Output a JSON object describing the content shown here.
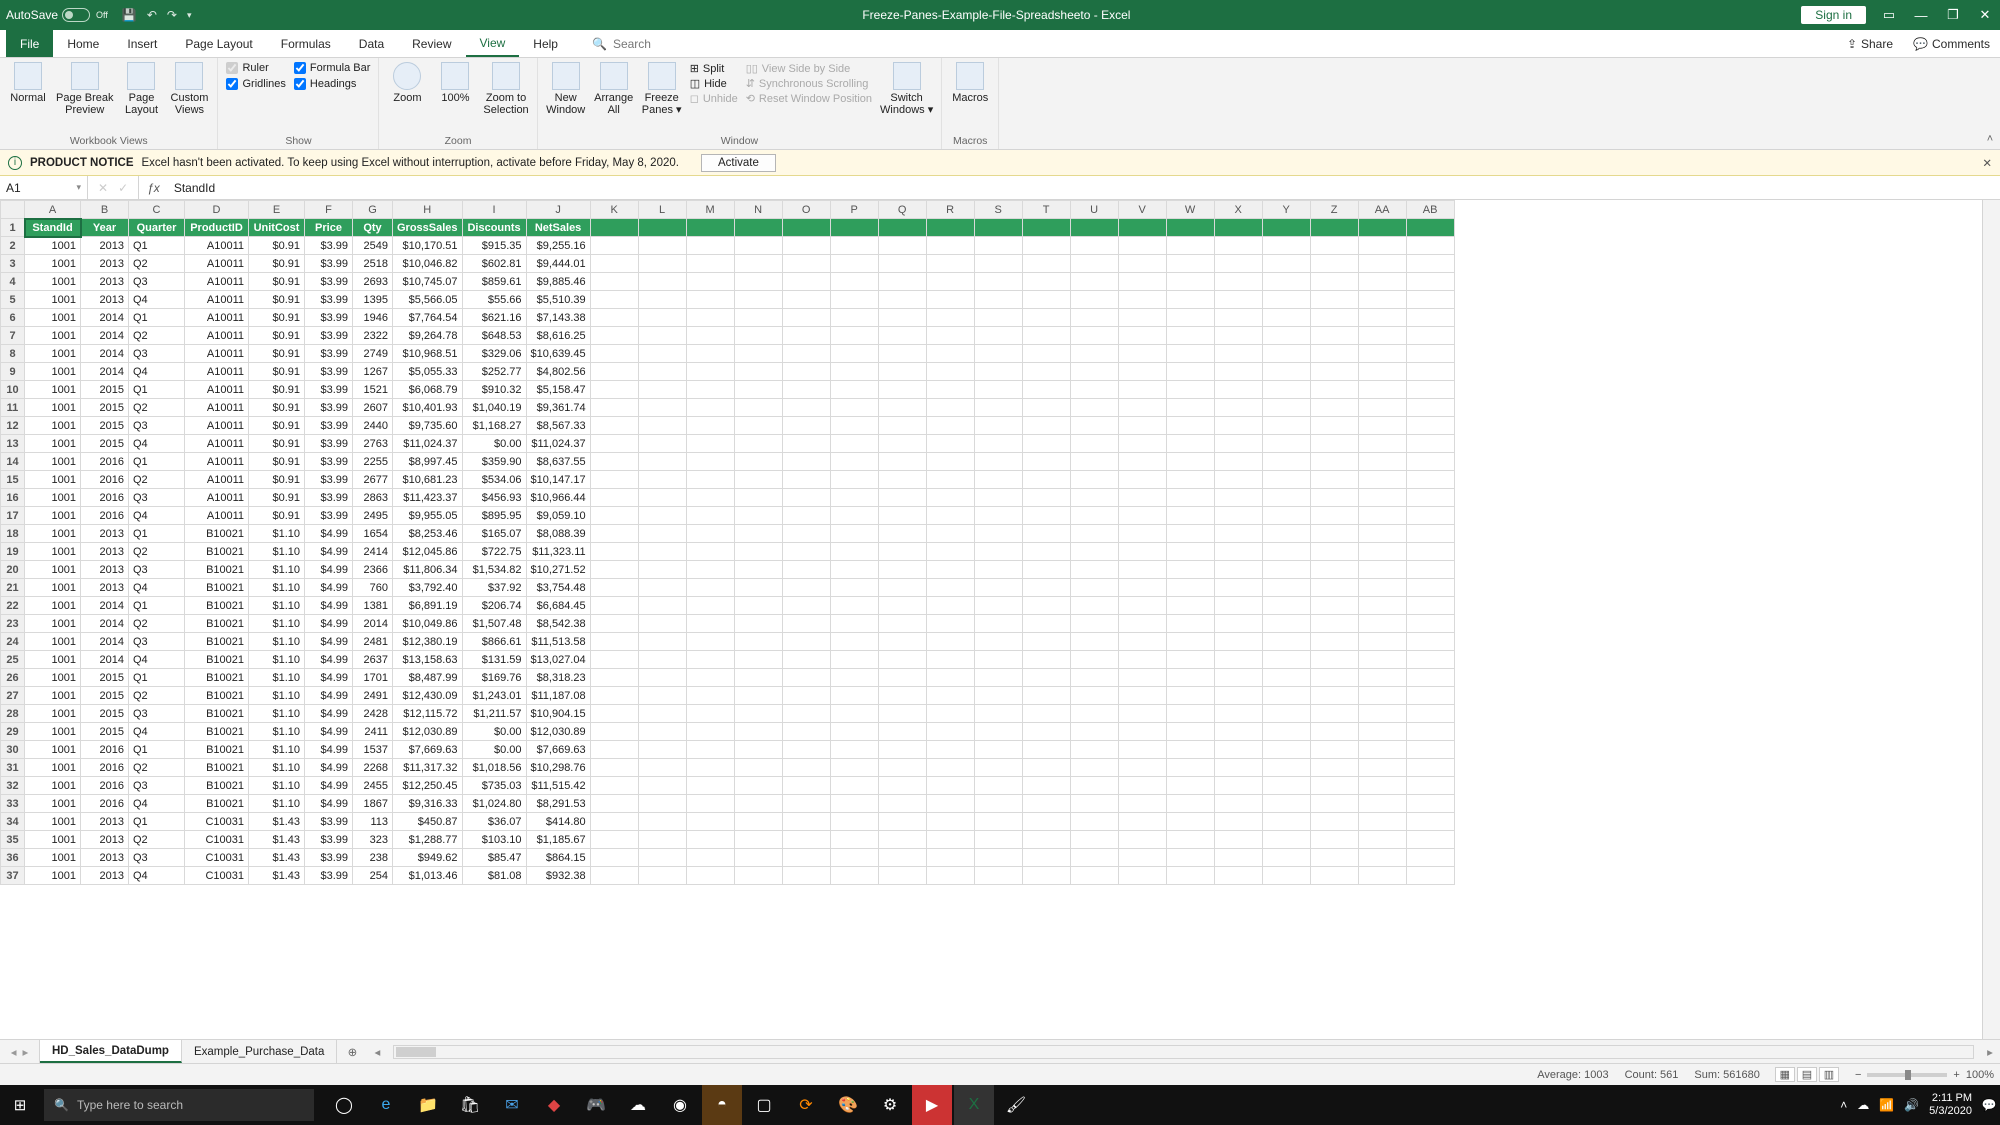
{
  "title_bar": {
    "autosave_label": "AutoSave",
    "autosave_state": "Off",
    "doc_title": "Freeze-Panes-Example-File-Spreadsheeto  -  Excel",
    "sign_in": "Sign in"
  },
  "menu": {
    "tabs": [
      "File",
      "Home",
      "Insert",
      "Page Layout",
      "Formulas",
      "Data",
      "Review",
      "View",
      "Help"
    ],
    "active_index": 7,
    "search_placeholder": "Search",
    "share": "Share",
    "comments": "Comments"
  },
  "ribbon": {
    "workbook_views": {
      "label": "Workbook Views",
      "normal": "Normal",
      "page_break": "Page Break\nPreview",
      "page_layout": "Page\nLayout",
      "custom_views": "Custom\nViews"
    },
    "show": {
      "label": "Show",
      "ruler": "Ruler",
      "formula_bar": "Formula Bar",
      "gridlines": "Gridlines",
      "headings": "Headings"
    },
    "zoom": {
      "label": "Zoom",
      "zoom": "Zoom",
      "hundred": "100%",
      "to_selection": "Zoom to\nSelection"
    },
    "window": {
      "label": "Window",
      "new_window": "New\nWindow",
      "arrange_all": "Arrange\nAll",
      "freeze_panes": "Freeze\nPanes ▾",
      "split": "Split",
      "hide": "Hide",
      "unhide": "Unhide",
      "side_by_side": "View Side by Side",
      "sync_scroll": "Synchronous Scrolling",
      "reset_pos": "Reset Window Position",
      "switch_windows": "Switch\nWindows ▾"
    },
    "macros": {
      "label": "Macros",
      "macros": "Macros"
    }
  },
  "message_bar": {
    "title": "PRODUCT NOTICE",
    "text": "Excel hasn't been activated. To keep using Excel without interruption, activate before Friday, May 8, 2020.",
    "button": "Activate"
  },
  "name_box": "A1",
  "formula_bar": "StandId",
  "columns": [
    "A",
    "B",
    "C",
    "D",
    "E",
    "F",
    "G",
    "H",
    "I",
    "J",
    "K",
    "L",
    "M",
    "N",
    "O",
    "P",
    "Q",
    "R",
    "S",
    "T",
    "U",
    "V",
    "W",
    "X",
    "Y",
    "Z",
    "AA",
    "AB"
  ],
  "headers": [
    "StandId",
    "Year",
    "Quarter",
    "ProductID",
    "UnitCost",
    "Price",
    "Qty",
    "GrossSales",
    "Discounts",
    "NetSales"
  ],
  "rows": [
    [
      "1001",
      "2013",
      "Q1",
      "A10011",
      "$0.91",
      "$3.99",
      "2549",
      "$10,170.51",
      "$915.35",
      "$9,255.16"
    ],
    [
      "1001",
      "2013",
      "Q2",
      "A10011",
      "$0.91",
      "$3.99",
      "2518",
      "$10,046.82",
      "$602.81",
      "$9,444.01"
    ],
    [
      "1001",
      "2013",
      "Q3",
      "A10011",
      "$0.91",
      "$3.99",
      "2693",
      "$10,745.07",
      "$859.61",
      "$9,885.46"
    ],
    [
      "1001",
      "2013",
      "Q4",
      "A10011",
      "$0.91",
      "$3.99",
      "1395",
      "$5,566.05",
      "$55.66",
      "$5,510.39"
    ],
    [
      "1001",
      "2014",
      "Q1",
      "A10011",
      "$0.91",
      "$3.99",
      "1946",
      "$7,764.54",
      "$621.16",
      "$7,143.38"
    ],
    [
      "1001",
      "2014",
      "Q2",
      "A10011",
      "$0.91",
      "$3.99",
      "2322",
      "$9,264.78",
      "$648.53",
      "$8,616.25"
    ],
    [
      "1001",
      "2014",
      "Q3",
      "A10011",
      "$0.91",
      "$3.99",
      "2749",
      "$10,968.51",
      "$329.06",
      "$10,639.45"
    ],
    [
      "1001",
      "2014",
      "Q4",
      "A10011",
      "$0.91",
      "$3.99",
      "1267",
      "$5,055.33",
      "$252.77",
      "$4,802.56"
    ],
    [
      "1001",
      "2015",
      "Q1",
      "A10011",
      "$0.91",
      "$3.99",
      "1521",
      "$6,068.79",
      "$910.32",
      "$5,158.47"
    ],
    [
      "1001",
      "2015",
      "Q2",
      "A10011",
      "$0.91",
      "$3.99",
      "2607",
      "$10,401.93",
      "$1,040.19",
      "$9,361.74"
    ],
    [
      "1001",
      "2015",
      "Q3",
      "A10011",
      "$0.91",
      "$3.99",
      "2440",
      "$9,735.60",
      "$1,168.27",
      "$8,567.33"
    ],
    [
      "1001",
      "2015",
      "Q4",
      "A10011",
      "$0.91",
      "$3.99",
      "2763",
      "$11,024.37",
      "$0.00",
      "$11,024.37"
    ],
    [
      "1001",
      "2016",
      "Q1",
      "A10011",
      "$0.91",
      "$3.99",
      "2255",
      "$8,997.45",
      "$359.90",
      "$8,637.55"
    ],
    [
      "1001",
      "2016",
      "Q2",
      "A10011",
      "$0.91",
      "$3.99",
      "2677",
      "$10,681.23",
      "$534.06",
      "$10,147.17"
    ],
    [
      "1001",
      "2016",
      "Q3",
      "A10011",
      "$0.91",
      "$3.99",
      "2863",
      "$11,423.37",
      "$456.93",
      "$10,966.44"
    ],
    [
      "1001",
      "2016",
      "Q4",
      "A10011",
      "$0.91",
      "$3.99",
      "2495",
      "$9,955.05",
      "$895.95",
      "$9,059.10"
    ],
    [
      "1001",
      "2013",
      "Q1",
      "B10021",
      "$1.10",
      "$4.99",
      "1654",
      "$8,253.46",
      "$165.07",
      "$8,088.39"
    ],
    [
      "1001",
      "2013",
      "Q2",
      "B10021",
      "$1.10",
      "$4.99",
      "2414",
      "$12,045.86",
      "$722.75",
      "$11,323.11"
    ],
    [
      "1001",
      "2013",
      "Q3",
      "B10021",
      "$1.10",
      "$4.99",
      "2366",
      "$11,806.34",
      "$1,534.82",
      "$10,271.52"
    ],
    [
      "1001",
      "2013",
      "Q4",
      "B10021",
      "$1.10",
      "$4.99",
      "760",
      "$3,792.40",
      "$37.92",
      "$3,754.48"
    ],
    [
      "1001",
      "2014",
      "Q1",
      "B10021",
      "$1.10",
      "$4.99",
      "1381",
      "$6,891.19",
      "$206.74",
      "$6,684.45"
    ],
    [
      "1001",
      "2014",
      "Q2",
      "B10021",
      "$1.10",
      "$4.99",
      "2014",
      "$10,049.86",
      "$1,507.48",
      "$8,542.38"
    ],
    [
      "1001",
      "2014",
      "Q3",
      "B10021",
      "$1.10",
      "$4.99",
      "2481",
      "$12,380.19",
      "$866.61",
      "$11,513.58"
    ],
    [
      "1001",
      "2014",
      "Q4",
      "B10021",
      "$1.10",
      "$4.99",
      "2637",
      "$13,158.63",
      "$131.59",
      "$13,027.04"
    ],
    [
      "1001",
      "2015",
      "Q1",
      "B10021",
      "$1.10",
      "$4.99",
      "1701",
      "$8,487.99",
      "$169.76",
      "$8,318.23"
    ],
    [
      "1001",
      "2015",
      "Q2",
      "B10021",
      "$1.10",
      "$4.99",
      "2491",
      "$12,430.09",
      "$1,243.01",
      "$11,187.08"
    ],
    [
      "1001",
      "2015",
      "Q3",
      "B10021",
      "$1.10",
      "$4.99",
      "2428",
      "$12,115.72",
      "$1,211.57",
      "$10,904.15"
    ],
    [
      "1001",
      "2015",
      "Q4",
      "B10021",
      "$1.10",
      "$4.99",
      "2411",
      "$12,030.89",
      "$0.00",
      "$12,030.89"
    ],
    [
      "1001",
      "2016",
      "Q1",
      "B10021",
      "$1.10",
      "$4.99",
      "1537",
      "$7,669.63",
      "$0.00",
      "$7,669.63"
    ],
    [
      "1001",
      "2016",
      "Q2",
      "B10021",
      "$1.10",
      "$4.99",
      "2268",
      "$11,317.32",
      "$1,018.56",
      "$10,298.76"
    ],
    [
      "1001",
      "2016",
      "Q3",
      "B10021",
      "$1.10",
      "$4.99",
      "2455",
      "$12,250.45",
      "$735.03",
      "$11,515.42"
    ],
    [
      "1001",
      "2016",
      "Q4",
      "B10021",
      "$1.10",
      "$4.99",
      "1867",
      "$9,316.33",
      "$1,024.80",
      "$8,291.53"
    ],
    [
      "1001",
      "2013",
      "Q1",
      "C10031",
      "$1.43",
      "$3.99",
      "113",
      "$450.87",
      "$36.07",
      "$414.80"
    ],
    [
      "1001",
      "2013",
      "Q2",
      "C10031",
      "$1.43",
      "$3.99",
      "323",
      "$1,288.77",
      "$103.10",
      "$1,185.67"
    ],
    [
      "1001",
      "2013",
      "Q3",
      "C10031",
      "$1.43",
      "$3.99",
      "238",
      "$949.62",
      "$85.47",
      "$864.15"
    ],
    [
      "1001",
      "2013",
      "Q4",
      "C10031",
      "$1.43",
      "$3.99",
      "254",
      "$1,013.46",
      "$81.08",
      "$932.38"
    ]
  ],
  "sheet_tabs": {
    "tabs": [
      "HD_Sales_DataDump",
      "Example_Purchase_Data"
    ],
    "active_index": 0
  },
  "status_bar": {
    "average": "Average: 1003",
    "count": "Count: 561",
    "sum": "Sum: 561680",
    "zoom": "100%"
  },
  "taskbar": {
    "search_placeholder": "Type here to search",
    "time": "2:11 PM",
    "date": "5/3/2020"
  }
}
